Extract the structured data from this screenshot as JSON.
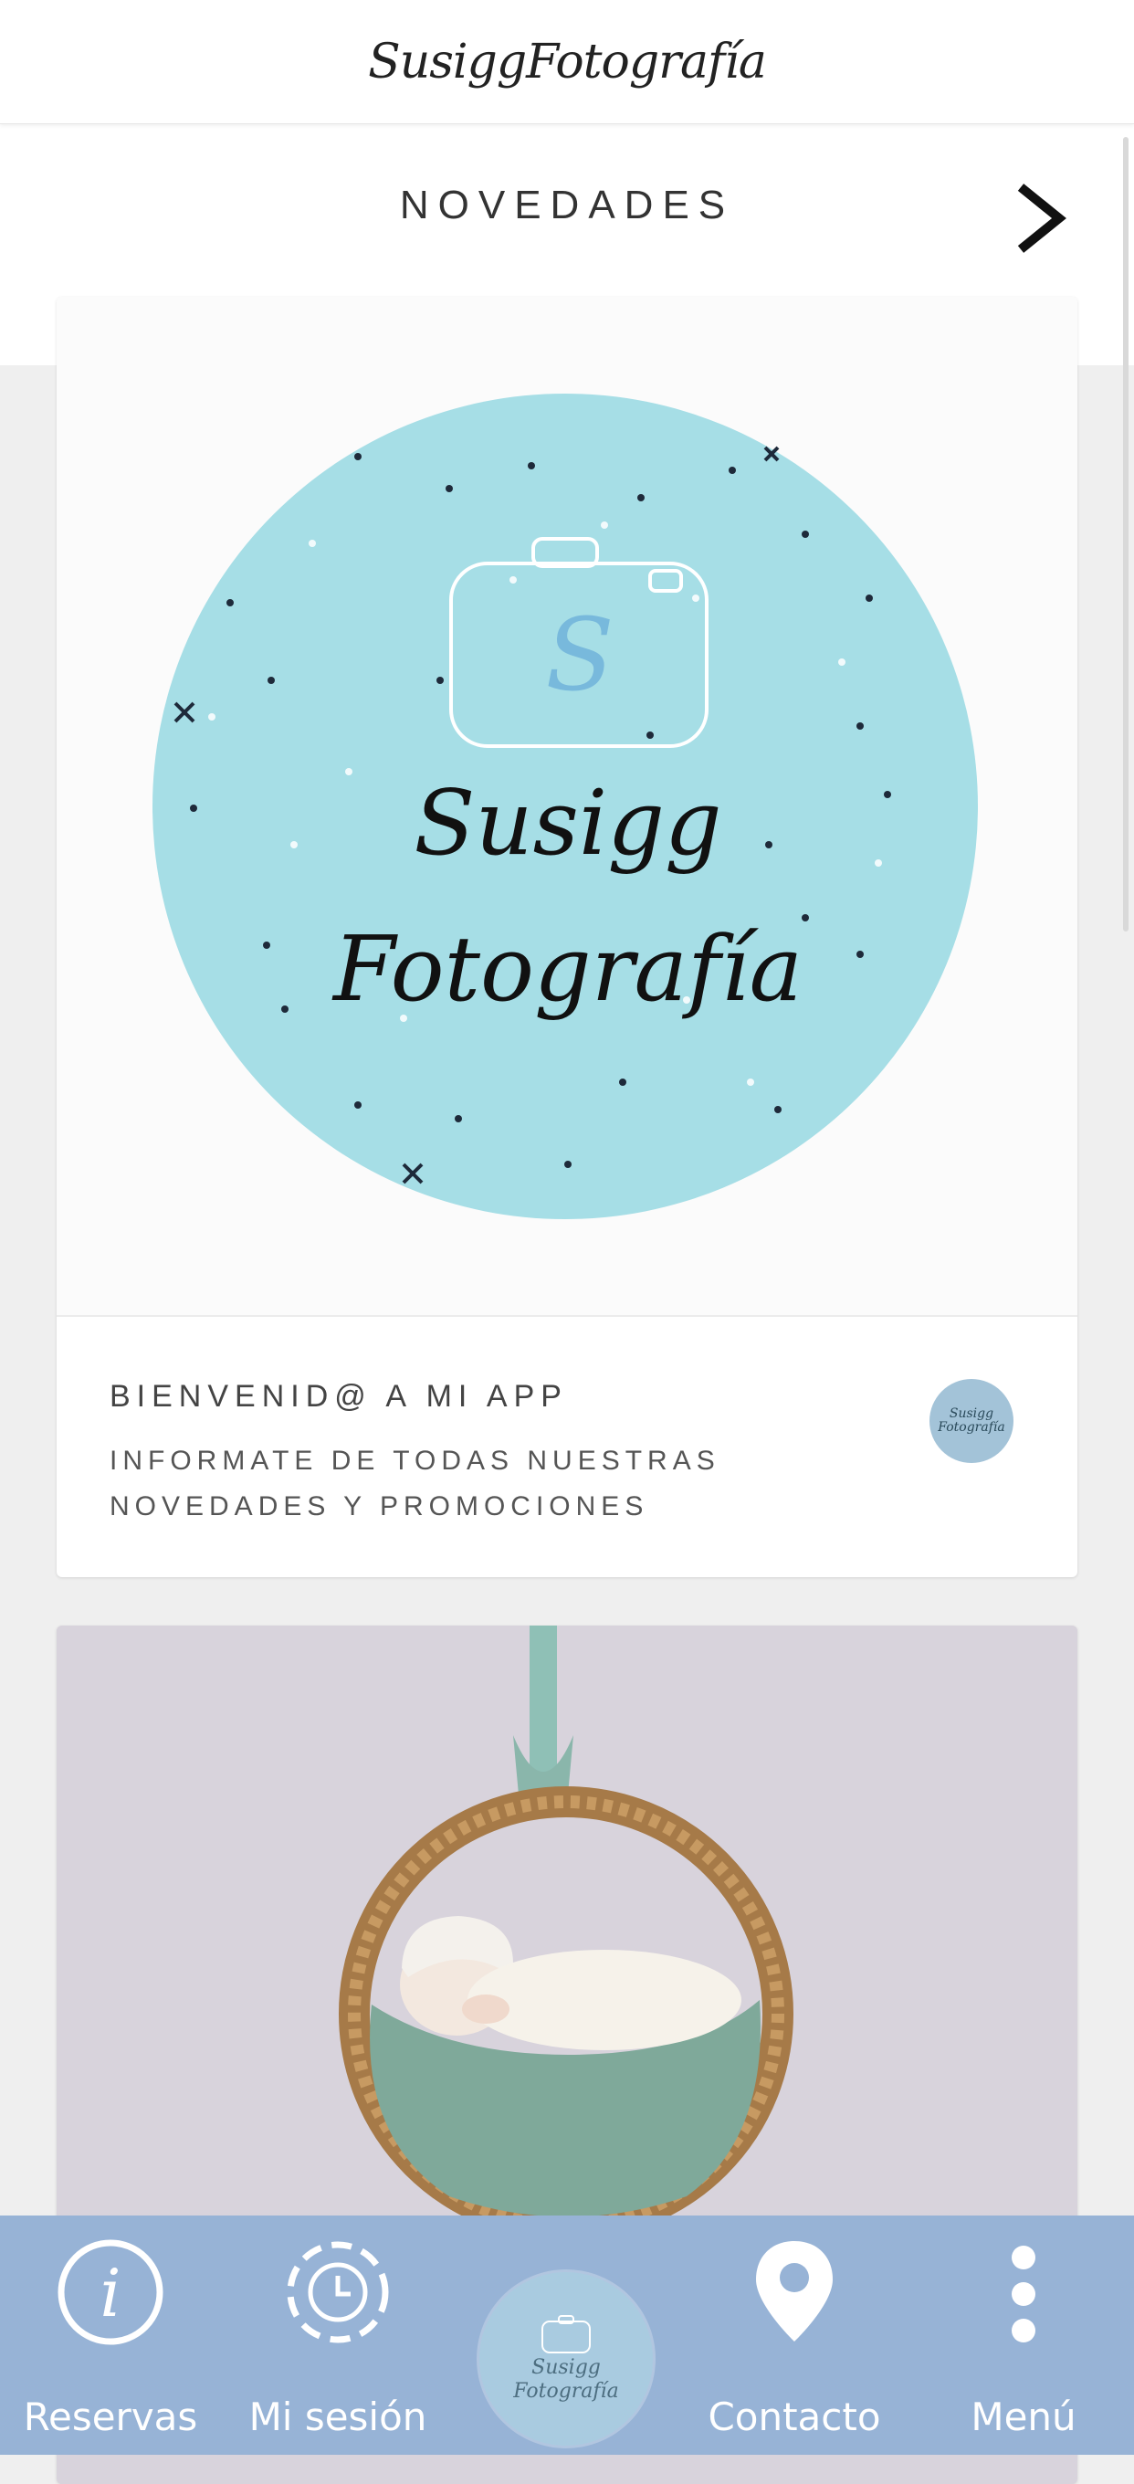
{
  "header": {
    "brand": "SusiggFotografía"
  },
  "section": {
    "title": "NOVEDADES"
  },
  "cards": [
    {
      "logo_lines": [
        "Susigg",
        "Fotografía"
      ],
      "title": "BIENVENID@ A MI APP",
      "description": "INFORMATE DE TODAS NUESTRAS NOVEDADES Y PROMOCIONES",
      "avatar_lines": [
        "Susigg",
        "Fotografía"
      ]
    },
    {
      "image": "newborn-in-hanging-basket-photo"
    }
  ],
  "nav": {
    "items": [
      {
        "label": "Reservas",
        "icon": "info-icon"
      },
      {
        "label": "Mi sesión",
        "icon": "clock-dashed-icon"
      },
      {
        "label": "Contacto",
        "icon": "map-pin-icon"
      },
      {
        "label": "Menú",
        "icon": "more-vertical-icon"
      }
    ],
    "center_lines": [
      "Susigg",
      "Fotografía"
    ]
  },
  "colors": {
    "nav_bg": "#97b3d6",
    "logo_circle": "#a6dee6",
    "page_bg": "#efefef"
  }
}
